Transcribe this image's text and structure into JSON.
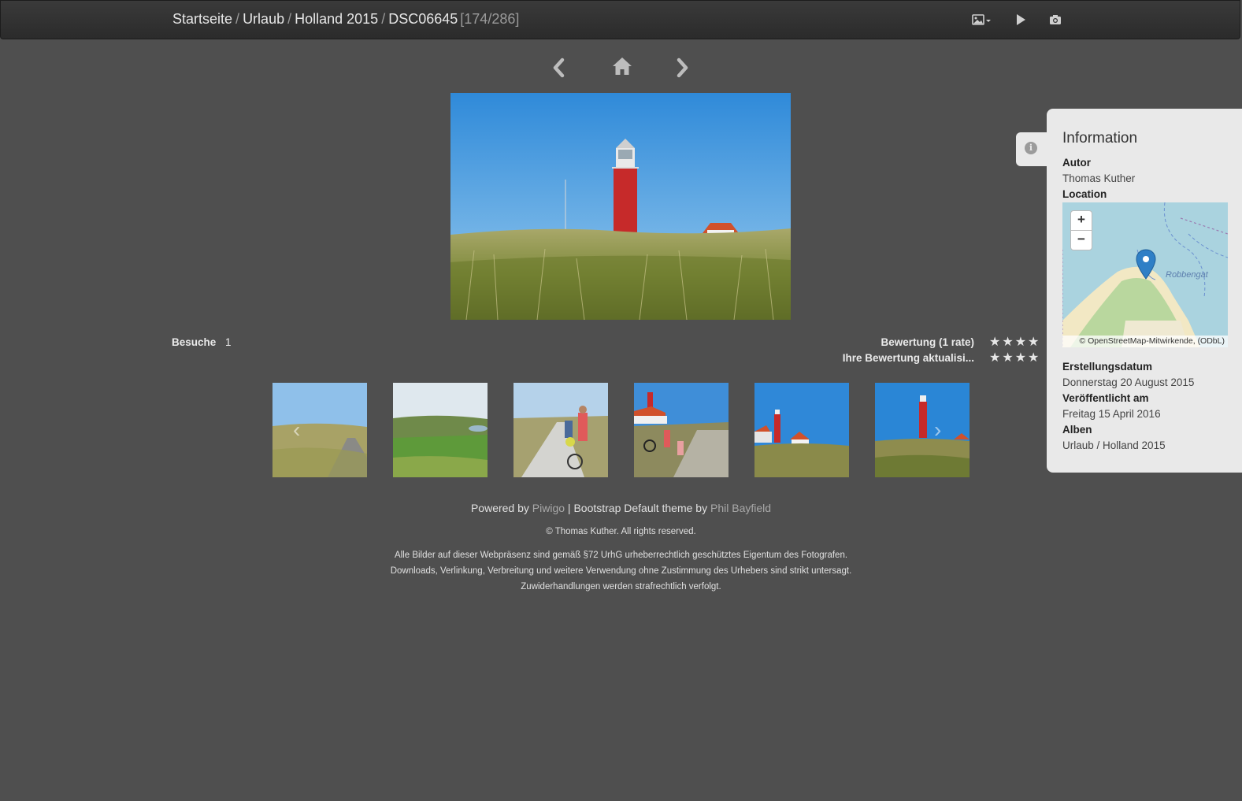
{
  "breadcrumb": {
    "items": [
      "Startseite",
      "Urlaub",
      "Holland 2015"
    ],
    "current": "DSC06645",
    "position": "[174/286]"
  },
  "toolbar": {
    "icons": [
      "image-size-icon",
      "slideshow-play-icon",
      "camera-icon"
    ]
  },
  "image_nav": {
    "icons": [
      "previous-arrow-icon",
      "home-icon",
      "next-arrow-icon"
    ]
  },
  "main_photo": {
    "subject": "lighthouse"
  },
  "stats": {
    "visits_label": "Besuche",
    "visits_value": "1",
    "rating_label": "Bewertung (1 rate)",
    "rating_stars": "★★★★",
    "your_rating_label": "Ihre Bewertung aktualisi...",
    "your_rating_stars": "★★★★"
  },
  "thumbnails": [
    {
      "name": "thumb-dune-road"
    },
    {
      "name": "thumb-green-marsh"
    },
    {
      "name": "thumb-cyclists-path"
    },
    {
      "name": "thumb-bikes-lighthouse"
    },
    {
      "name": "thumb-lighthouse-house"
    },
    {
      "name": "thumb-lighthouse-grass"
    }
  ],
  "footer": {
    "powered_prefix": "Powered by",
    "piwigo": "Piwigo",
    "theme_text": "| Bootstrap Default theme by",
    "author_link": "Phil Bayfield",
    "copyright": "© Thomas Kuther. All rights reserved.",
    "notice_1": "Alle Bilder auf dieser Webpräsenz sind gemäß §72 UrhG urheberrechtlich geschütztes Eigentum des Fotografen.",
    "notice_2": "Downloads, Verlinkung, Verbreitung und weitere Verwendung ohne Zustimmung des Urhebers sind strikt untersagt.",
    "notice_3": "Zuwiderhandlungen werden strafrechtlich verfolgt."
  },
  "info": {
    "title": "Information",
    "author_label": "Autor",
    "author": "Thomas Kuther",
    "location_label": "Location",
    "map": {
      "zoom_in": "+",
      "zoom_out": "−",
      "place_label": "Robbengat",
      "attribution": "© OpenStreetMap-Mitwirkende, (ODbL)"
    },
    "created_label": "Erstellungsdatum",
    "created": "Donnerstag 20 August 2015",
    "published_label": "Veröffentlicht am",
    "published": "Freitag 15 April 2016",
    "albums_label": "Alben",
    "albums": "Urlaub / Holland 2015"
  }
}
